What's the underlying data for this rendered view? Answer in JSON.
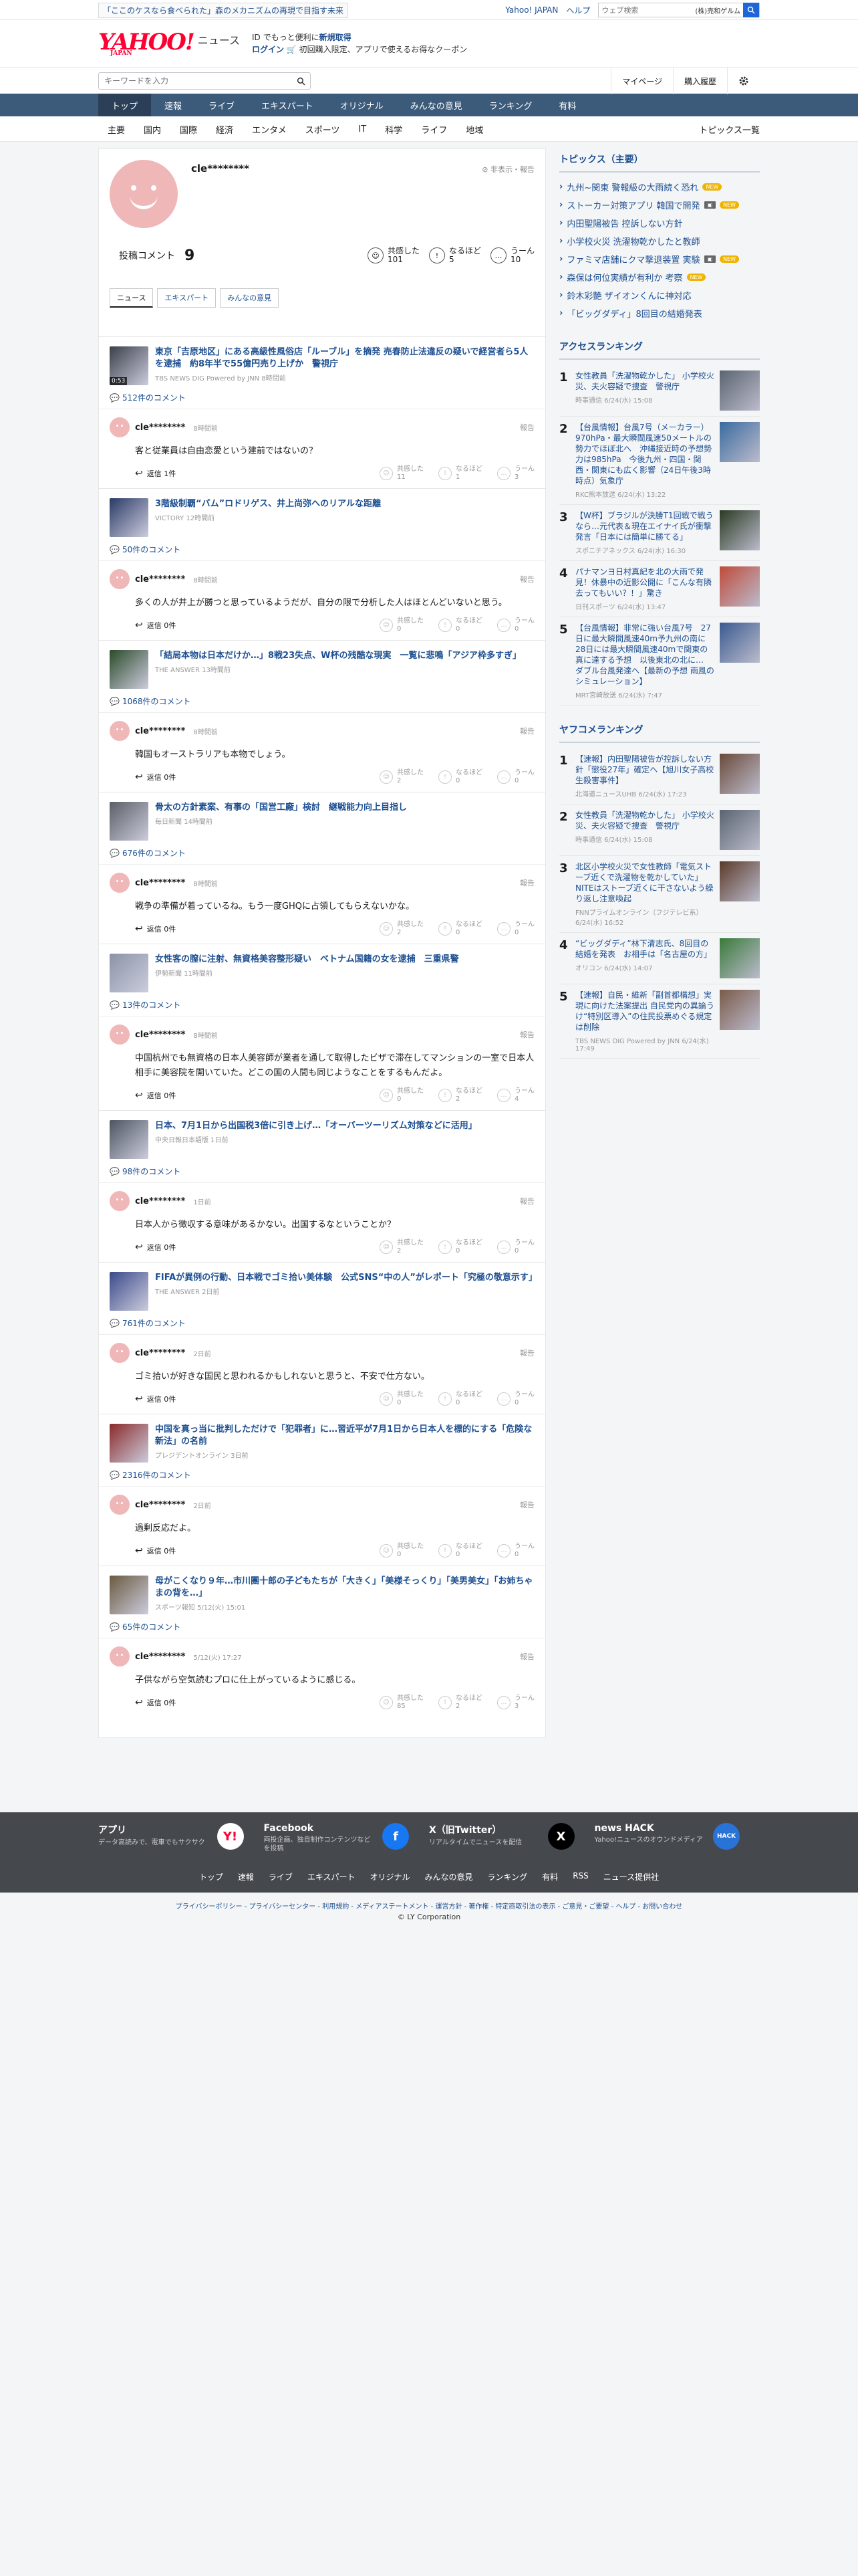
{
  "top_strip": {
    "promo": "「ここのケスなら食べられた」森のメカニズムの再現で目指す未来",
    "links": [
      "Yahoo! JAPAN",
      "ヘルプ"
    ],
    "search_placeholder": "ウェブ検索",
    "search_hint": "(株)売和ゲルム"
  },
  "masthead": {
    "logo": "YAHOO!",
    "logo_sub": "JAPAN",
    "section": "ニュース",
    "promo_line1_pre": "ID でもっと便利に",
    "promo_line1_link": "新規取得",
    "promo_line2_link": "ログイン",
    "promo_line2_rest": "初回購入限定、アプリで使えるお得なクーポン"
  },
  "toolbar": {
    "search_placeholder": "キーワードを入力",
    "mypage": "マイページ",
    "history": "購入履歴"
  },
  "global_nav": [
    "トップ",
    "速報",
    "ライブ",
    "エキスパート",
    "オリジナル",
    "みんなの意見",
    "ランキング",
    "有料"
  ],
  "sub_nav": [
    "主要",
    "国内",
    "国際",
    "経済",
    "エンタメ",
    "スポーツ",
    "IT",
    "科学",
    "ライフ",
    "地域"
  ],
  "sub_nav_right": "トピックス一覧",
  "profile": {
    "name": "cle********",
    "report": "非表示・報告",
    "comments_label": "投稿コメント",
    "comments_count": "9",
    "reactions": [
      {
        "label": "共感した",
        "count": "101"
      },
      {
        "label": "なるほど",
        "count": "5"
      },
      {
        "label": "うーん",
        "count": "10"
      }
    ],
    "tabs": [
      "ニュース",
      "エキスパート",
      "みんなの意見"
    ]
  },
  "entries": [
    {
      "title": "東京「吉原地区」にある高級性風俗店「ルーブル」を摘発 売春防止法違反の疑いで経営者ら5人を逮捕　約8年半で55億円売り上げか　警視庁",
      "source": "TBS NEWS DIG Powered by JNN 8時間前",
      "duration": "0:53",
      "comment_count": "512件のコメント",
      "user": "cle********",
      "time": "8時間前",
      "report": "報告",
      "text": "客と従業員は自由恋愛という建前ではないの？",
      "replies": "返信 1件",
      "r1": "共感した",
      "r1n": "11",
      "r2": "なるほど",
      "r2n": "1",
      "r3": "うーん",
      "r3n": "3",
      "thumb": "#3a3f4a"
    },
    {
      "title": "3階級制覇“バム”ロドリゲス、井上尚弥へのリアルな距離",
      "source": "VICTORY 12時間前",
      "duration": "",
      "comment_count": "50件のコメント",
      "user": "cle********",
      "time": "8時間前",
      "report": "報告",
      "text": "多くの人が井上が勝つと思っているようだが、自分の限で分析した人はほとんどいないと思う。",
      "replies": "返信 0件",
      "r1": "共感した",
      "r1n": "0",
      "r2": "なるほど",
      "r2n": "0",
      "r3": "うーん",
      "r3n": "0",
      "thumb": "#2a3a66"
    },
    {
      "title": "「結局本物は日本だけか…」8戦23失点、W杯の残酷な現実　一覧に悲鳴「アジア枠多すぎ」",
      "source": "THE ANSWER 13時間前",
      "duration": "",
      "comment_count": "1068件のコメント",
      "user": "cle********",
      "time": "8時間前",
      "report": "報告",
      "text": "韓国もオーストラリアも本物でしょう。",
      "replies": "返信 0件",
      "r1": "共感した",
      "r1n": "2",
      "r2": "なるほど",
      "r2n": "0",
      "r3": "うーん",
      "r3n": "0",
      "thumb": "#2b4a2a"
    },
    {
      "title": "骨太の方針素案、有事の「国営工廠」検討　継戦能力向上目指し",
      "source": "毎日新聞 14時間前",
      "duration": "",
      "comment_count": "676件のコメント",
      "user": "cle********",
      "time": "8時間前",
      "report": "報告",
      "text": "戦争の準備が着っているね。もう一度GHQに占領してもらえないかな。",
      "replies": "返信 0件",
      "r1": "共感した",
      "r1n": "2",
      "r2": "なるほど",
      "r2n": "0",
      "r3": "うーん",
      "r3n": "0",
      "thumb": "#5a5f66"
    },
    {
      "title": "女性客の膣に注射、無資格美容整形疑い　ベトナム国籍の女を逮捕　三重県警",
      "source": "伊勢新聞 11時間前",
      "duration": "",
      "comment_count": "13件のコメント",
      "user": "cle********",
      "time": "8時間前",
      "report": "報告",
      "text": "中国杭州でも無資格の日本人美容師が業者を通して取得したビザで滞在してマンションの一室で日本人相手に美容院を開いていた。どこの国の人間も同じようなことをするもんだよ。",
      "replies": "返信 0件",
      "r1": "共感した",
      "r1n": "0",
      "r2": "なるほど",
      "r2n": "2",
      "r3": "うーん",
      "r3n": "4",
      "thumb": "#8a94a6"
    },
    {
      "title": "日本、7月1日から出国税3倍に引き上げ…「オーバーツーリズム対策などに活用」",
      "source": "中央日報日本語版 1日前",
      "duration": "",
      "comment_count": "98件のコメント",
      "user": "cle********",
      "time": "1日前",
      "report": "報告",
      "text": "日本人から徴収する意味があるかない。出国するなということか？",
      "replies": "返信 0件",
      "r1": "共感した",
      "r1n": "2",
      "r2": "なるほど",
      "r2n": "0",
      "r3": "うーん",
      "r3n": "0",
      "thumb": "#4d5560"
    },
    {
      "title": "FIFAが異例の行動、日本戦でゴミ拾い美体験　公式SNS“中の人”がレポート「究極の敬意示す」",
      "source": "THE ANSWER 2日前",
      "duration": "",
      "comment_count": "761件のコメント",
      "user": "cle********",
      "time": "2日前",
      "report": "報告",
      "text": "ゴミ拾いが好きな国民と思われるかもしれないと思うと、不安で仕方ない。",
      "replies": "返信 0件",
      "r1": "共感した",
      "r1n": "0",
      "r2": "なるほど",
      "r2n": "0",
      "r3": "うーん",
      "r3n": "0",
      "thumb": "#3a4a8a"
    },
    {
      "title": "中国を真っ当に批判しただけで「犯罪者」に…習近平が7月1日から日本人を標的にする「危険な新法」の名前",
      "source": "プレジデントオンライン 3日前",
      "duration": "",
      "comment_count": "2316件のコメント",
      "user": "cle********",
      "time": "2日前",
      "report": "報告",
      "text": "過剰反応だよ。",
      "replies": "返信 0件",
      "r1": "共感した",
      "r1n": "0",
      "r2": "なるほど",
      "r2n": "0",
      "r3": "うーん",
      "r3n": "0",
      "thumb": "#8a2a2a"
    },
    {
      "title": "母がこくなり９年…市川團十郎の子どもたちが「大きく」「美様そっくり」「美男美女」「お姉ちゃまの背を…」",
      "source": "スポーツ報知 5/12(火) 15:01",
      "duration": "",
      "comment_count": "65件のコメント",
      "user": "cle********",
      "time": "5/12(火) 17:27",
      "report": "報告",
      "text": "子供ながら空気読むプロに仕上がっているように感じる。",
      "replies": "返信 0件",
      "r1": "共感した",
      "r1n": "85",
      "r2": "なるほど",
      "r2n": "2",
      "r3": "うーん",
      "r3n": "3",
      "thumb": "#6a5a40"
    }
  ],
  "topics": {
    "heading": "トピックス（主要）",
    "items": [
      {
        "text": "九州~関東 警報級の大雨続く恐れ",
        "badge": "NEW"
      },
      {
        "text": "ストーカー対策アプリ 韓国で開発",
        "badge": "IMG+NEW"
      },
      {
        "text": "内田聖陽被告 控訴しない方針",
        "badge": ""
      },
      {
        "text": "小学校火災 洗濯物乾かしたと教師",
        "badge": ""
      },
      {
        "text": "ファミマ店舗にクマ撃退装置 実験",
        "badge": "IMG+NEW"
      },
      {
        "text": "森保は何位実績が有利か 考察",
        "badge": "NEW"
      },
      {
        "text": "鈴木彩艶 ザイオンくんに神対応",
        "badge": ""
      },
      {
        "text": "「ビッグダディ」8回目の結婚発表",
        "badge": ""
      }
    ]
  },
  "access_ranking": {
    "heading": "アクセスランキング",
    "items": [
      {
        "n": "1",
        "title": "女性教員「洗濯物乾かした」 小学校火災、夫火容疑で捜査　警視庁",
        "src": "時事通信 6/24(水) 15:08",
        "c": "#5a6470"
      },
      {
        "n": "2",
        "title": "【台風情報】台風7号（メーカラー）970hPa・最大瞬間風速50メートルの勢力でほぼ北へ　沖縄接近時の予想勢力は985hPa　今後九州・四国・関西・関東にも広く影響（24日午後3時時点）気象庁",
        "src": "RKC熊本放送 6/24(水) 13:22",
        "c": "#3a6aa0"
      },
      {
        "n": "3",
        "title": "【W杯】ブラジルが決勝T1回戦で戦うなら…元代表＆現在エイナイ氏が衝撃発言「日本には簡単に勝てる」",
        "src": "スポニチアネックス 6/24(水) 16:30",
        "c": "#2a3a22"
      },
      {
        "n": "4",
        "title": "パナマンヨ日村真紀を北の大雨で発見！休暴中の近影公開に「こんな有隣去ってもいい？！」驚き",
        "src": "日刊スポーツ 6/24(水) 13:47",
        "c": "#c04a3a"
      },
      {
        "n": "5",
        "title": "【台風情報】非常に強い台風7号　27日に最大瞬間風速40m予九州の南に　28日には最大瞬間風速40mで関東の真に達する予想　以後東北の北に…　ダブル台風発達へ【最新の予想 雨風のシミュレーション】",
        "src": "MRT宮崎放送 6/24(水) 7:47",
        "c": "#3a5a90"
      }
    ]
  },
  "yafuko_ranking": {
    "heading": "ヤフコメランキング",
    "items": [
      {
        "n": "1",
        "title": "【速報】内田聖陽被告が控訴しない方針「懲役27年」確定へ【旭川女子高校生殺害事件】",
        "src": "北海道ニュースUHB 6/24(水) 17:23",
        "c": "#6a4a3a"
      },
      {
        "n": "2",
        "title": "女性教員「洗濯物乾かした」 小学校火災、夫火容疑で捜査　警視庁",
        "src": "時事通信 6/24(水) 15:08",
        "c": "#5a6470"
      },
      {
        "n": "3",
        "title": "北区小学校火災で女性教師「電気ストーブ近くで洗濯物を乾かしていた」 NITEはストーブ近くに干さないよう繰り返し注意喚起",
        "src": "FNNプライムオンライン（フジテレビ系） 6/24(水) 16:52",
        "c": "#5a3a2a"
      },
      {
        "n": "4",
        "title": "“ビッグダディ”林下清志氏、8回目の結婚を発表　お相手は「名古屋の方」",
        "src": "オリコン 6/24(水) 14:07",
        "c": "#3a7a3a"
      },
      {
        "n": "5",
        "title": "【速報】自民・維新「副首都構想」実現に向けた法案提出 自民党内の異論うけ“特別区導入”の住民投票めぐる規定は削除",
        "src": "TBS NEWS DIG Powered by JNN 6/24(水) 17:49",
        "c": "#7a5a4a"
      }
    ]
  },
  "footer": {
    "cols": [
      {
        "title": "アプリ",
        "desc": "データ高読みで、電車でもサクサク",
        "icon": "Y!",
        "bg": "#fff",
        "fg": "#ff0033"
      },
      {
        "title": "Facebook",
        "desc": "両投企画、独自制作コンテンツなどを投稿",
        "icon": "f",
        "bg": "#1877f2",
        "fg": "#fff"
      },
      {
        "title": "X（旧Twitter）",
        "desc": "リアルタイムでニュースを配信",
        "icon": "X",
        "bg": "#000",
        "fg": "#fff"
      },
      {
        "title": "news HACK",
        "desc": "Yahoo!ニュースのオウンドメディア",
        "icon": "HACK",
        "bg": "#2a73d6",
        "fg": "#fff"
      }
    ],
    "nav": [
      "トップ",
      "速報",
      "ライブ",
      "エキスパート",
      "オリジナル",
      "みんなの意見",
      "ランキング",
      "有料",
      "RSS",
      "ニュース提供社"
    ],
    "legal": "プライバシーポリシー - プライバシーセンター - 利用規約 - メディアステートメント - 運営方針 - 著作権 - 特定商取引法の表示 - ご意見・ご要望 - ヘルプ - お問い合わせ",
    "copyright": "© LY Corporation"
  },
  "colors": {
    "accent": "#1d4f91",
    "brand": "#ff0033",
    "nav_bg": "#3c5a7a",
    "avatar": "#efb7b7"
  }
}
